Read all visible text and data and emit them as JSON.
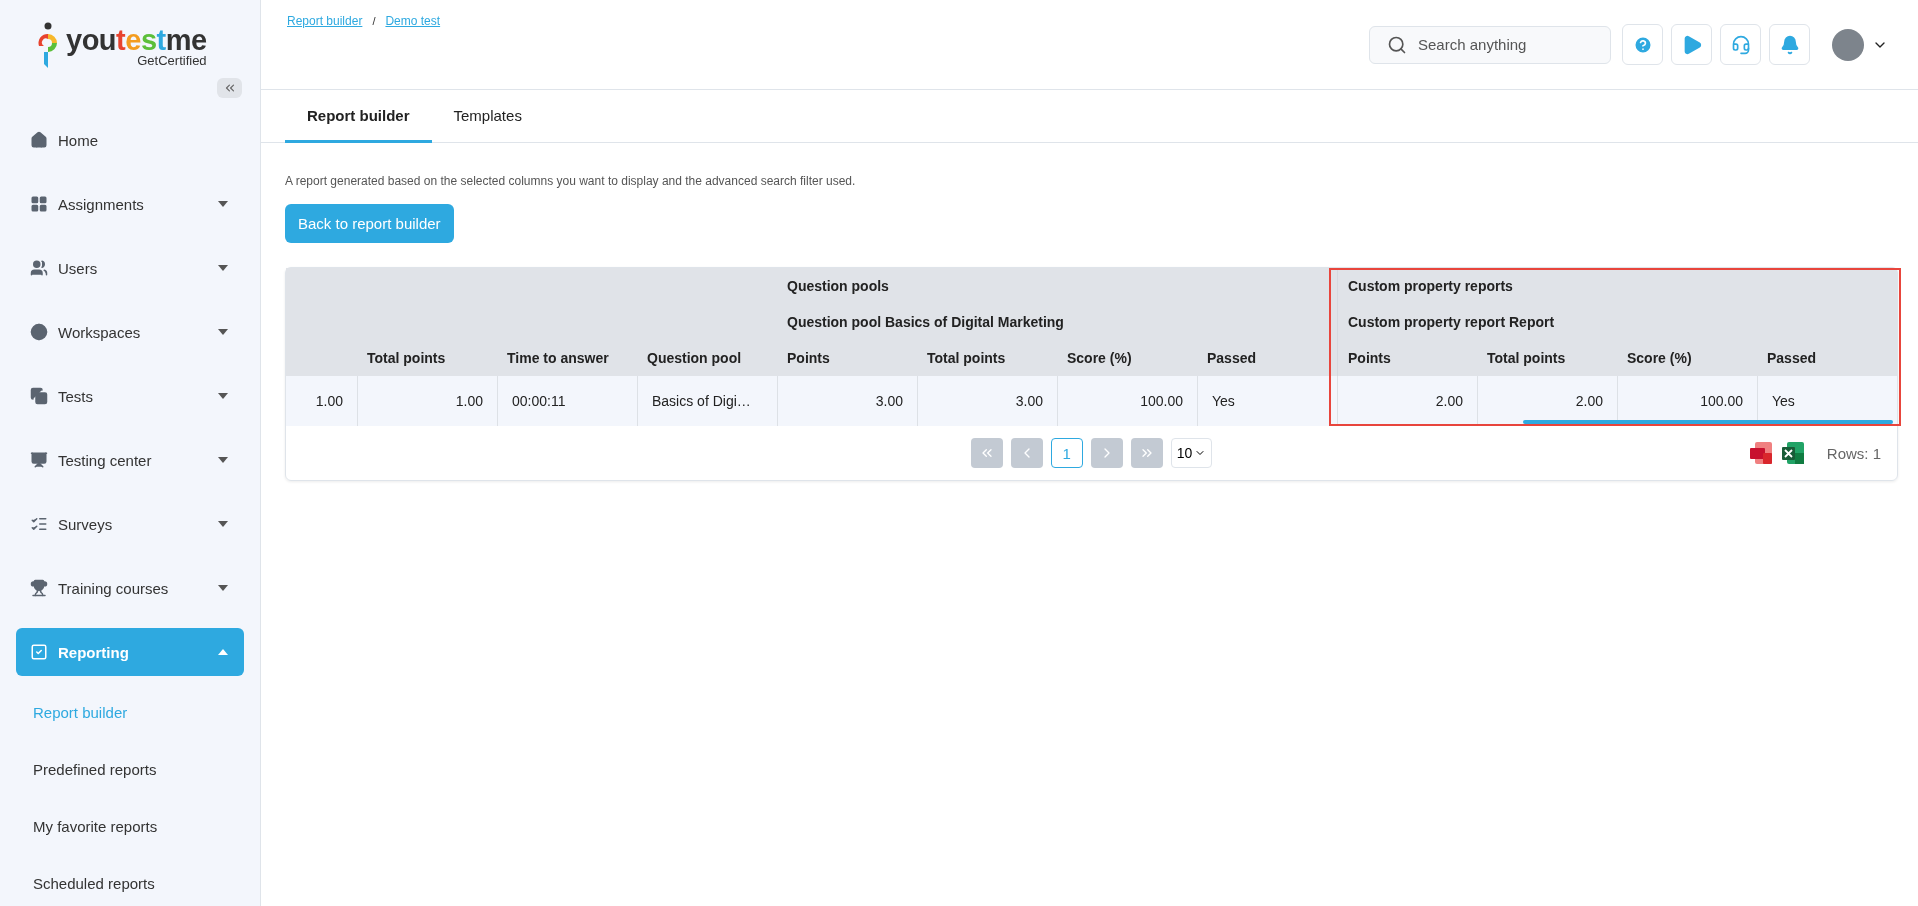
{
  "logo": {
    "parts": [
      {
        "text": "you",
        "color": "#333333"
      },
      {
        "text": "t",
        "color": "#e8432e"
      },
      {
        "text": "e",
        "color": "#f39c1f"
      },
      {
        "text": "s",
        "color": "#5cbf3a"
      },
      {
        "text": "t",
        "color": "#2ea9e0"
      },
      {
        "text": "me",
        "color": "#333333"
      }
    ],
    "tagline": "GetCertified"
  },
  "sidebar": {
    "items": [
      {
        "label": "Home",
        "kind": "link",
        "selected": false
      },
      {
        "label": "Assignments",
        "kind": "group",
        "selected": false,
        "expanded": false
      },
      {
        "label": "Users",
        "kind": "group",
        "selected": false,
        "expanded": false
      },
      {
        "label": "Workspaces",
        "kind": "group",
        "selected": false,
        "expanded": false
      },
      {
        "label": "Tests",
        "kind": "group",
        "selected": false,
        "expanded": false
      },
      {
        "label": "Testing center",
        "kind": "group",
        "selected": false,
        "expanded": false
      },
      {
        "label": "Surveys",
        "kind": "group",
        "selected": false,
        "expanded": false
      },
      {
        "label": "Training courses",
        "kind": "group",
        "selected": false,
        "expanded": false
      },
      {
        "label": "Reporting",
        "kind": "group",
        "selected": true,
        "expanded": true,
        "children": [
          {
            "label": "Report builder",
            "selected": true
          },
          {
            "label": "Predefined reports",
            "selected": false
          },
          {
            "label": "My favorite reports",
            "selected": false
          },
          {
            "label": "Scheduled reports",
            "selected": false
          }
        ]
      }
    ]
  },
  "breadcrumb": {
    "items": [
      "Report builder",
      "Demo test"
    ],
    "separator": "/"
  },
  "search": {
    "placeholder": "Search anything"
  },
  "tabs": [
    {
      "label": "Report builder",
      "selected": true
    },
    {
      "label": "Templates",
      "selected": false
    }
  ],
  "description": "A report generated based on the selected columns you want to display and the advanced search filter used.",
  "back_button": "Back to report builder",
  "table": {
    "leading_columns": [
      {
        "kind": "number"
      },
      {
        "label": "Total points",
        "kind": "number"
      },
      {
        "label": "Time to answer",
        "kind": "text"
      },
      {
        "label": "Question pool",
        "kind": "text"
      }
    ],
    "groups": [
      {
        "label": "Question pools",
        "subgroup": "Question pool Basics of Digital Marketing",
        "highlighted": false,
        "columns": [
          {
            "label": "Points",
            "kind": "number"
          },
          {
            "label": "Total points",
            "kind": "number"
          },
          {
            "label": "Score (%)",
            "kind": "number"
          },
          {
            "label": "Passed",
            "kind": "text"
          }
        ]
      },
      {
        "label": "Custom property reports",
        "subgroup": "Custom property report Report",
        "highlighted": true,
        "columns": [
          {
            "label": "Points",
            "kind": "number"
          },
          {
            "label": "Total points",
            "kind": "number"
          },
          {
            "label": "Score (%)",
            "kind": "number"
          },
          {
            "label": "Passed",
            "kind": "text"
          }
        ]
      }
    ],
    "rows": [
      [
        "1.00",
        "1.00",
        "00:00:11",
        "Basics of Digi…",
        "3.00",
        "3.00",
        "100.00",
        "Yes",
        "2.00",
        "2.00",
        "100.00",
        "Yes"
      ]
    ]
  },
  "pagination": {
    "pages": [
      {
        "label": "1",
        "selected": true
      }
    ],
    "page_size": "10",
    "rows": "Rows: 1"
  }
}
